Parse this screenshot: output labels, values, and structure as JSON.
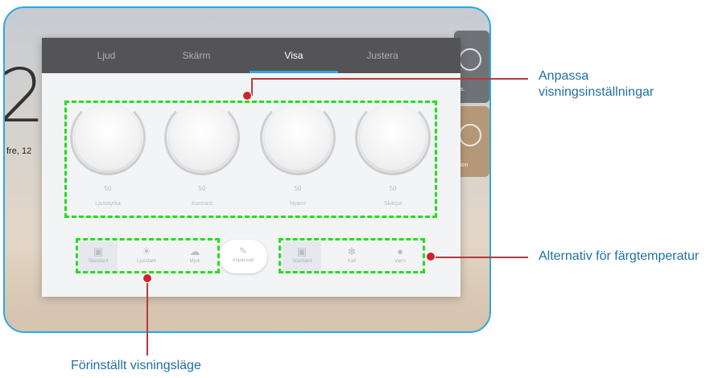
{
  "background": {
    "big_digit": "2",
    "date_text": "fre, 12",
    "tile_1_label": "s.",
    "tile_2_label": "ion"
  },
  "tabs": [
    {
      "label": "Ljud",
      "active": false
    },
    {
      "label": "Skärm",
      "active": false
    },
    {
      "label": "Visa",
      "active": true
    },
    {
      "label": "Justera",
      "active": false
    }
  ],
  "knobs": [
    {
      "value": "50",
      "label": "Ljusstyrka"
    },
    {
      "value": "50",
      "label": "Kontrast"
    },
    {
      "value": "50",
      "label": "Nyans"
    },
    {
      "value": "50",
      "label": "Skärpa"
    }
  ],
  "preset_modes": [
    {
      "label": "Standard",
      "icon": "monitor-icon",
      "selected": true
    },
    {
      "label": "Ljusstark",
      "icon": "sun-icon",
      "selected": false
    },
    {
      "label": "Mjuk",
      "icon": "cloud-icon",
      "selected": false
    }
  ],
  "custom_mode": {
    "label": "Anpassad",
    "icon": "pencil-icon"
  },
  "color_temps": [
    {
      "label": "Standard",
      "icon": "monitor-icon",
      "selected": true
    },
    {
      "label": "Kall",
      "icon": "snowflake-icon",
      "selected": false
    },
    {
      "label": "Varm",
      "icon": "flame-icon",
      "selected": false
    }
  ],
  "annotations": {
    "display_settings": "Anpassa visningsinställningar",
    "color_temperature": "Alternativ för färgtemperatur",
    "preset_display_mode": "Förinställt visningsläge",
    "box_color": "#22e01c",
    "dot_color": "#d4202a",
    "text_color": "#1f6fa3"
  },
  "colors": {
    "frame": "#2aa9e6",
    "tabbar": "#545456",
    "active_tab_indicator": "#2ea7df"
  }
}
